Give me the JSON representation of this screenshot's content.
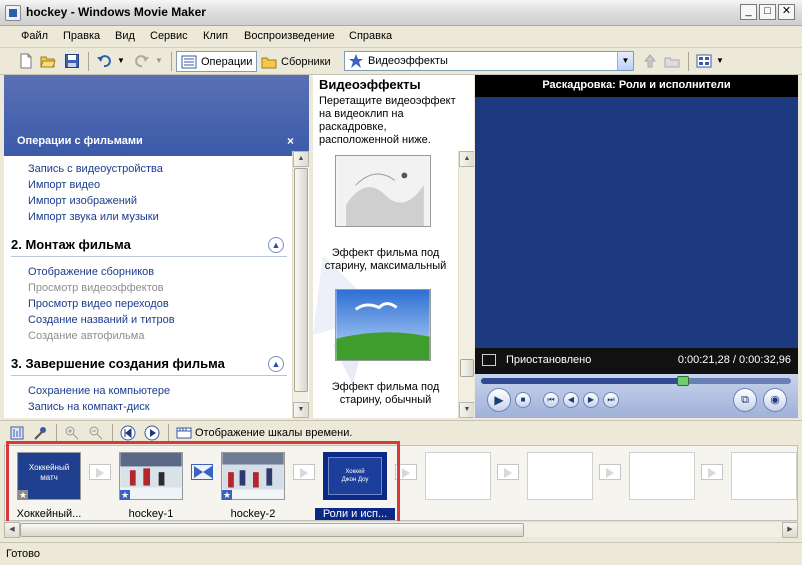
{
  "window": {
    "title": "hockey - Windows Movie Maker"
  },
  "menu": [
    "Файл",
    "Правка",
    "Вид",
    "Сервис",
    "Клип",
    "Воспроизведение",
    "Справка"
  ],
  "toolbar": {
    "operations_label": "Операции",
    "collections_label": "Сборники",
    "collection_selected": "Видеоэффекты"
  },
  "task_pane": {
    "title": "Операции с фильмами",
    "close_glyph": "×",
    "capture_links": [
      "Запись с видеоустройства",
      "Импорт видео",
      "Импорт изображений",
      "Импорт звука или музыки"
    ],
    "edit_section": "2. Монтаж фильма",
    "edit_links": [
      {
        "text": "Отображение сборников",
        "enabled": true
      },
      {
        "text": "Просмотр видеоэффектов",
        "enabled": false
      },
      {
        "text": "Просмотр видео переходов",
        "enabled": true
      },
      {
        "text": "Создание названий и титров",
        "enabled": true
      },
      {
        "text": "Создание автофильма",
        "enabled": false
      }
    ],
    "finish_section": "3. Завершение создания фильма",
    "finish_links": [
      "Сохранение на компьютере",
      "Запись на компакт-диск"
    ]
  },
  "collection_pane": {
    "title": "Видеоэффекты",
    "hint": "Перетащите видеоэффект на видеоклип на раскадровке, расположенной ниже.",
    "effects": [
      {
        "label": "Эффект фильма под старину, максимальный"
      },
      {
        "label": "Эффект фильма под старину, обычный"
      }
    ]
  },
  "preview": {
    "title": "Раскадровка: Роли и исполнители",
    "status": "Приостановлено",
    "time": "0:00:21,28 / 0:00:32,96",
    "progress_fraction": 0.65
  },
  "storyboard_toolbar": {
    "timeline_toggle_label": "Отображение шкалы времени."
  },
  "storyboard": {
    "clips": [
      {
        "label": "Хоккейный...",
        "thumb_text_1": "Хоккейный",
        "thumb_text_2": "матч",
        "selected": false
      },
      {
        "label": "hockey-1",
        "selected": false
      },
      {
        "label": "hockey-2",
        "selected": false
      },
      {
        "label": "Роли и исп...",
        "thumb_text_1": "Хоккей",
        "thumb_text_2": "Джон Доу",
        "selected": true
      }
    ]
  },
  "status_bar": {
    "text": "Готово"
  }
}
